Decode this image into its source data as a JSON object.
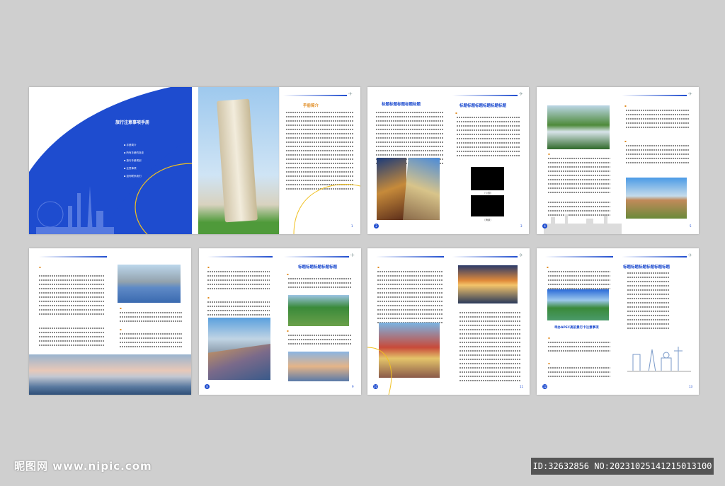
{
  "cover": {
    "title": "旅行注意事项手册",
    "menu": [
      "手册简介",
      "所有手册的封皮",
      "旅行手册规划",
      "注意事项",
      "如何联系我们"
    ]
  },
  "intro": {
    "title": "手册简介"
  },
  "headings": {
    "p2_left": "标题标题标题标题标题",
    "p2_right": "标题标题标题标题标题标题",
    "p6_right": "标题标题标题标题标题",
    "p8_right": "标题标题标题标题标题标题",
    "apec": "举办APEC高前景行卡注意事项"
  },
  "captions": {
    "c1": "（公园）",
    "c2": "（海景）"
  },
  "page_numbers": [
    "1",
    "2",
    "3",
    "4",
    "5",
    "8",
    "9",
    "10",
    "11",
    "12",
    "13"
  ],
  "watermark": {
    "site": "昵图网 www.nipic.com",
    "id": "ID:32632856 NO:20231025141215013100"
  },
  "colors": {
    "brand_blue": "#1e4ccf",
    "accent_orange": "#e08a1e",
    "accent_yellow": "#f0c020"
  }
}
